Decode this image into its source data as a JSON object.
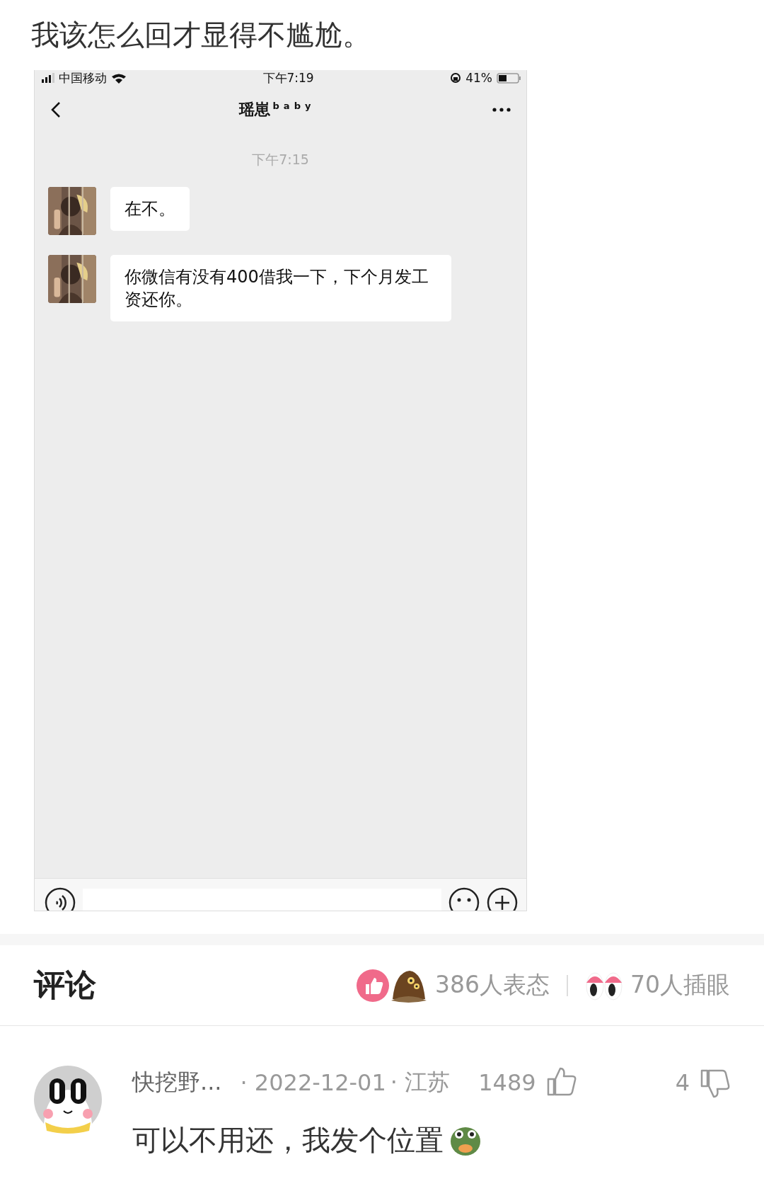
{
  "post": {
    "title": "我该怎么回才显得不尴尬。"
  },
  "chat_screenshot": {
    "status_bar": {
      "carrier": "中国移动",
      "time": "下午7:19",
      "battery": "41%"
    },
    "contact_name": "瑶崽$^{baby}$",
    "timestamp": "下午7:15",
    "messages": [
      {
        "text": "在不。"
      },
      {
        "text": "你微信有没有400借我一下，下个月发工资还你。"
      }
    ]
  },
  "comments_header": {
    "title": "评论",
    "reactions": "386人表态",
    "bookmarks": "70人插眼"
  },
  "comments": [
    {
      "user": "快挖野...",
      "date": "· 2022-12-01",
      "location": "· 江苏",
      "likes": "1489",
      "dislikes": "4",
      "text": "可以不用还，我发个位置"
    }
  ]
}
